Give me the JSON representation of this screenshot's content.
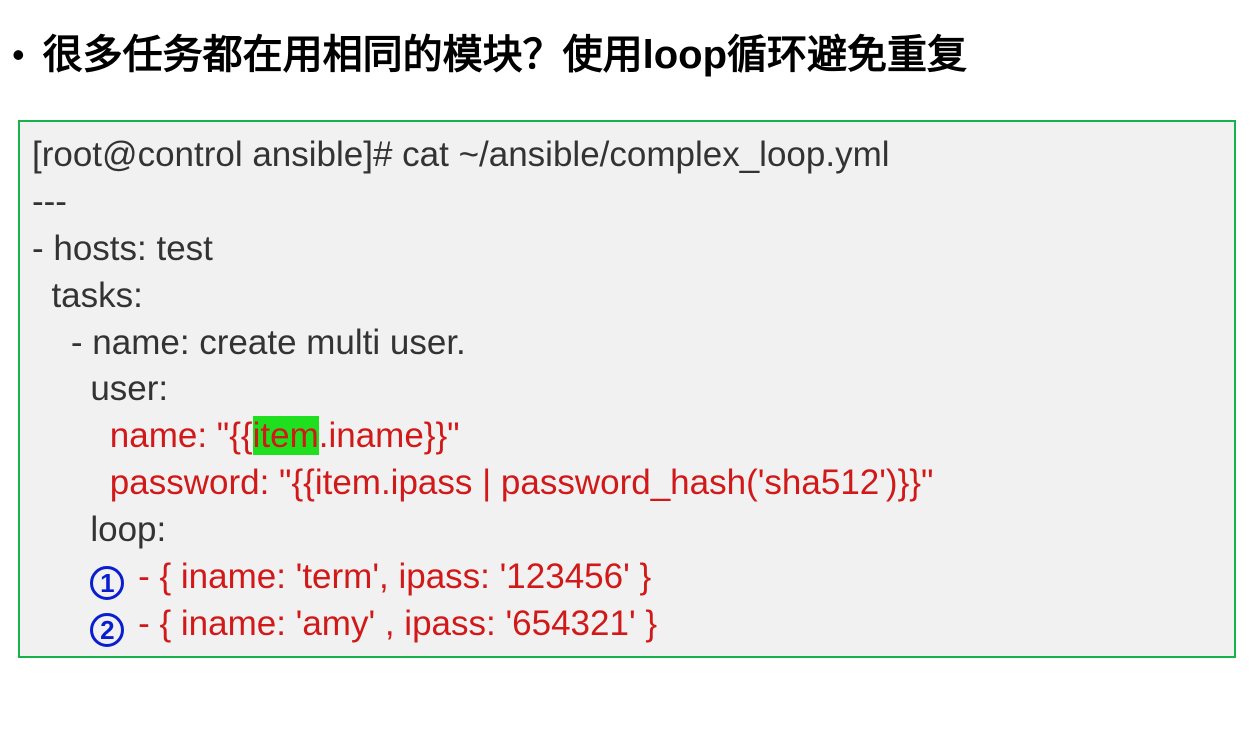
{
  "bullet": "很多任务都在用相同的模块？使用loop循环避免重复",
  "code": {
    "prompt": "[root@control ansible]# cat ~/ansible/complex_loop.yml",
    "dashes": "---",
    "hosts": "- hosts: test",
    "tasks": "  tasks:",
    "taskname": "    - name: create multi user.",
    "user": "      user:",
    "name_prefix": "        name: \"{{",
    "name_item": "item",
    "name_suffix": ".iname}}\"",
    "password": "        password: \"{{item.ipass | password_hash('sha512')}}\"",
    "loop": "      loop:",
    "n1": "1",
    "item1": " - { iname: 'term', ipass: '123456' }",
    "n2": "2",
    "item2": " - { iname: 'amy' , ipass: '654321' }"
  }
}
